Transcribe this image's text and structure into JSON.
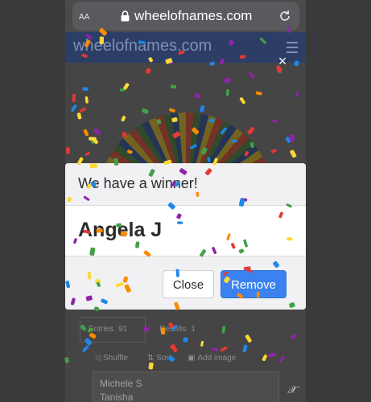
{
  "browser": {
    "aa_label": "AA",
    "url": "wheelofnames.com"
  },
  "site": {
    "logo_text": "wheelofnames.com"
  },
  "overlay": {
    "close_glyph": "×"
  },
  "modal": {
    "title": "We have a winner!",
    "winner": "Angela J",
    "close_label": "Close",
    "remove_label": "Remove"
  },
  "page": {
    "tabs": {
      "entries_label": "Entries",
      "entries_count": "91",
      "results_label": "Results",
      "results_count": "1"
    },
    "toolbar": {
      "shuffle_label": "Shuffle",
      "sort_label": "Sort",
      "add_image_label": "Add image"
    },
    "entries": [
      "Michele S",
      "Tanisha"
    ]
  },
  "watermark": "𝒳",
  "colors": {
    "accent": "#3b82f0",
    "header": "#2c3e66",
    "confetti": [
      "#e53935",
      "#43a047",
      "#1e88e5",
      "#fdd835",
      "#8e24aa",
      "#fb8c00"
    ]
  }
}
